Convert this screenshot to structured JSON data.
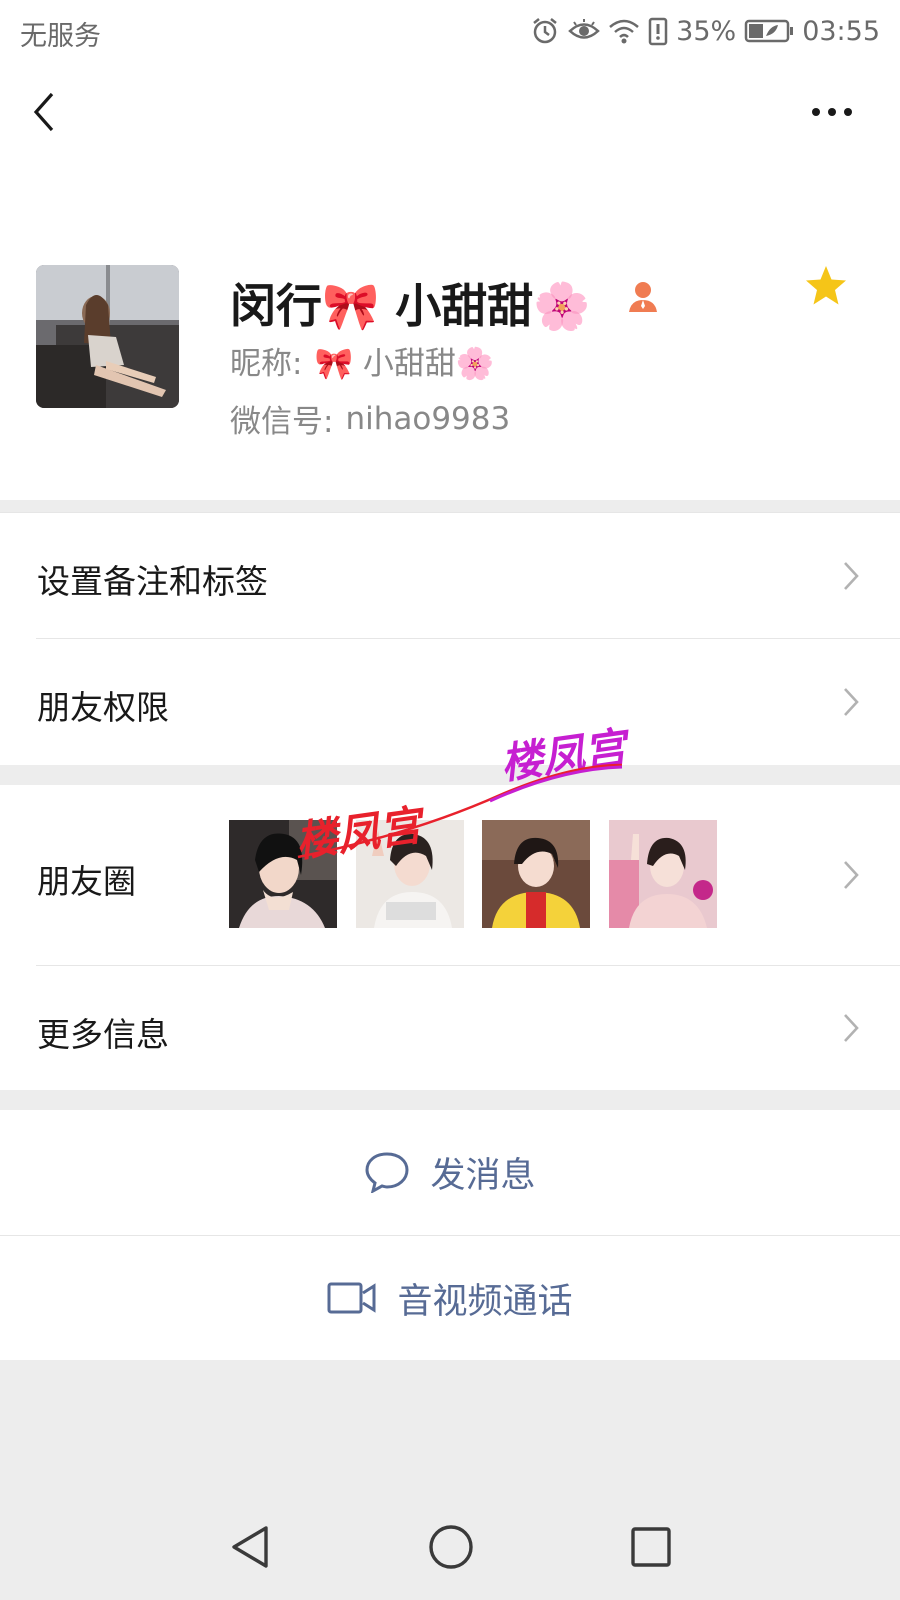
{
  "status_bar": {
    "carrier": "无服务",
    "battery_percent": "35%",
    "time": "03:55"
  },
  "nav": {
    "back_icon": "chevron-left-icon",
    "more_icon": "more-dots-icon"
  },
  "profile": {
    "display_name": "闵行🎀 小甜甜🌸",
    "nickname_label": "昵称:",
    "nickname_value": "🎀 小甜甜🌸",
    "wechat_id_label": "微信号:",
    "wechat_id_value": "nihao9983",
    "star_color": "#f5c518",
    "tag_color": "#f07c52"
  },
  "menu": {
    "remark_tags": "设置备注和标签",
    "permissions": "朋友权限",
    "moments": "朋友圈",
    "more_info": "更多信息"
  },
  "watermarks": {
    "text_1": "楼凤宫",
    "text_2": "楼凤宫"
  },
  "actions": {
    "send_message": "发消息",
    "video_call": "音视频通话",
    "accent_color": "#576b95"
  }
}
